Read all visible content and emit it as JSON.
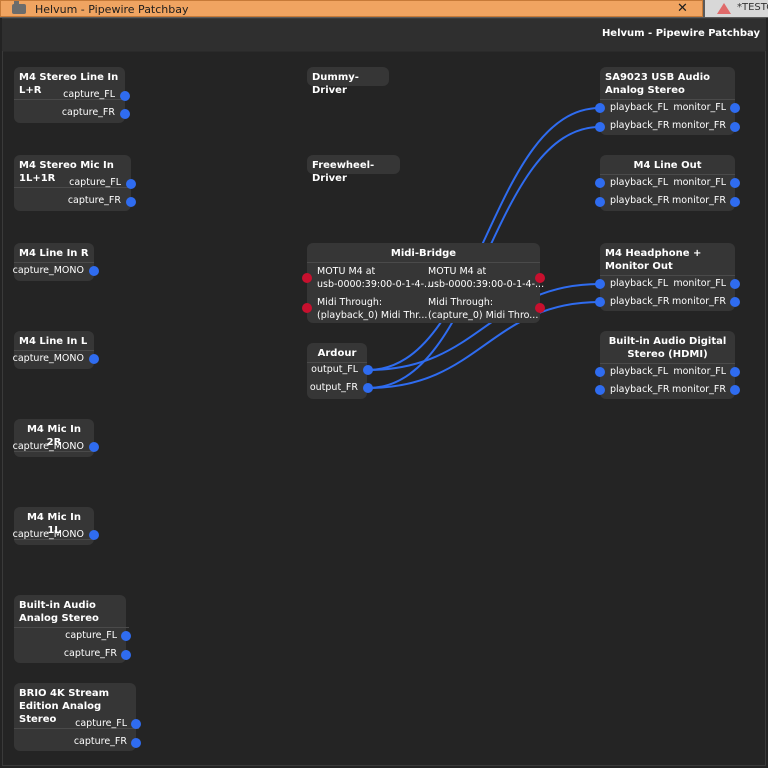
{
  "tabbar": {
    "active_title": "Helvum - Pipewire Patchbay",
    "close_glyph": "✕",
    "other_label": "*TESTC"
  },
  "header": {
    "title": "Helvum - Pipewire Patchbay"
  },
  "colors": {
    "audio_port": "#2f6cf0",
    "midi_port": "#c8102e",
    "wire": "#2f6cf0"
  },
  "nodes": {
    "m4_stereo_line_in": {
      "title": "M4 Stereo Line In L+R",
      "ports": [
        "capture_FL",
        "capture_FR"
      ]
    },
    "m4_stereo_mic_in": {
      "title": "M4 Stereo Mic In 1L+1R",
      "ports": [
        "capture_FL",
        "capture_FR"
      ]
    },
    "m4_line_in_r": {
      "title": "M4 Line In R",
      "ports": [
        "capture_MONO"
      ]
    },
    "m4_line_in_l": {
      "title": "M4 Line In L",
      "ports": [
        "capture_MONO"
      ]
    },
    "m4_mic_in_2r": {
      "title": "M4 Mic In 2R",
      "ports": [
        "capture_MONO"
      ]
    },
    "m4_mic_in_1l": {
      "title": "M4 Mic In 1L",
      "ports": [
        "capture_MONO"
      ]
    },
    "builtin_analog": {
      "title": "Built-in Audio Analog Stereo",
      "ports": [
        "capture_FL",
        "capture_FR"
      ]
    },
    "brio": {
      "title": "BRIO 4K Stream Edition Analog Stereo",
      "ports": [
        "capture_FL",
        "capture_FR"
      ]
    },
    "dummy_driver": {
      "title": "Dummy-Driver"
    },
    "freewheel_driver": {
      "title": "Freewheel-Driver"
    },
    "midi_bridge": {
      "title": "Midi-Bridge",
      "in_ports": [
        {
          "line1": "MOTU M4 at",
          "line2": "usb-0000:39:00-0-1-4-..."
        },
        {
          "line1": "Midi Through:",
          "line2": "(playback_0) Midi Thr..."
        }
      ],
      "out_ports": [
        {
          "line1": "MOTU M4 at",
          "line2": "usb-0000:39:00-0-1-4-..."
        },
        {
          "line1": "Midi Through:",
          "line2": "(capture_0) Midi Thro..."
        }
      ]
    },
    "ardour": {
      "title": "Ardour",
      "ports": [
        "output_FL",
        "output_FR"
      ]
    },
    "sa9023": {
      "title": "SA9023 USB Audio Analog Stereo",
      "in_ports": [
        "playback_FL",
        "playback_FR"
      ],
      "out_ports": [
        "monitor_FL",
        "monitor_FR"
      ]
    },
    "m4_line_out": {
      "title": "M4 Line Out",
      "in_ports": [
        "playback_FL",
        "playback_FR"
      ],
      "out_ports": [
        "monitor_FL",
        "monitor_FR"
      ]
    },
    "m4_headphone": {
      "title": "M4 Headphone + Monitor Out",
      "in_ports": [
        "playback_FL",
        "playback_FR"
      ],
      "out_ports": [
        "monitor_FL",
        "monitor_FR"
      ]
    },
    "builtin_hdmi": {
      "title": "Built-in Audio Digital Stereo (HDMI)",
      "in_ports": [
        "playback_FL",
        "playback_FR"
      ],
      "out_ports": [
        "monitor_FL",
        "monitor_FR"
      ]
    }
  }
}
